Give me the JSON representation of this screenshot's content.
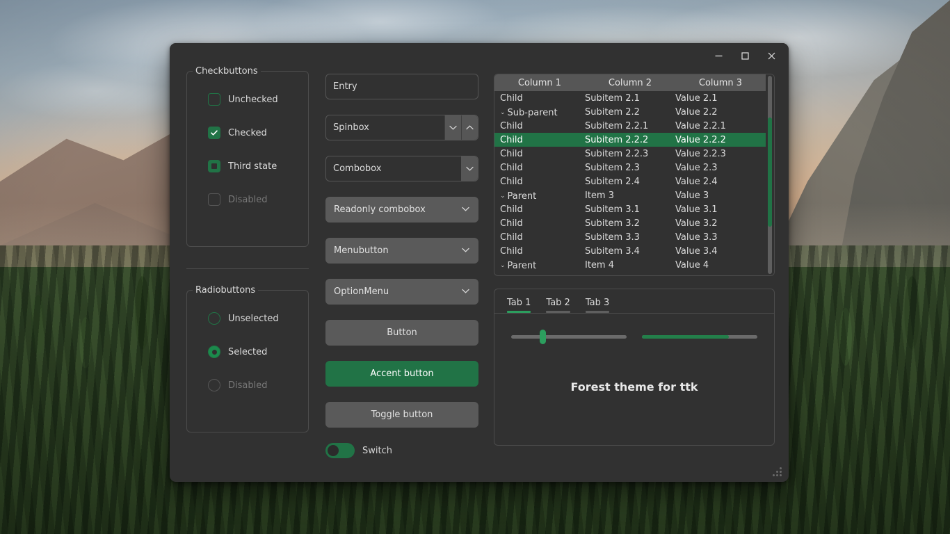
{
  "window": {
    "title": "Forest theme for ttk",
    "controls": {
      "minimize": "minimize-icon",
      "maximize": "maximize-icon",
      "close": "close-icon"
    }
  },
  "checkbuttons": {
    "title": "Checkbuttons",
    "items": [
      {
        "label": "Unchecked",
        "state": "unchecked"
      },
      {
        "label": "Checked",
        "state": "checked"
      },
      {
        "label": "Third state",
        "state": "third"
      },
      {
        "label": "Disabled",
        "state": "disabled"
      }
    ]
  },
  "radiobuttons": {
    "title": "Radiobuttons",
    "items": [
      {
        "label": "Unselected",
        "state": "unselected"
      },
      {
        "label": "Selected",
        "state": "selected"
      },
      {
        "label": "Disabled",
        "state": "disabled"
      }
    ]
  },
  "widgets": {
    "entry": {
      "value": "Entry",
      "placeholder": "Entry"
    },
    "spinbox": {
      "value": "Spinbox",
      "down_icon": "chevron-down-icon",
      "up_icon": "chevron-up-icon"
    },
    "combobox": {
      "value": "Combobox",
      "icon": "chevron-down-icon"
    },
    "readonly_combobox": {
      "value": "Readonly combobox",
      "icon": "chevron-down-icon"
    },
    "menubutton": {
      "value": "Menubutton",
      "icon": "chevron-down-icon"
    },
    "optionmenu": {
      "value": "OptionMenu",
      "icon": "chevron-down-icon"
    },
    "button": {
      "label": "Button"
    },
    "accent_button": {
      "label": "Accent button"
    },
    "toggle_button": {
      "label": "Toggle button"
    },
    "switch": {
      "label": "Switch",
      "state": "on"
    }
  },
  "treeview": {
    "columns": [
      "Column 1",
      "Column 2",
      "Column 3"
    ],
    "rows": [
      {
        "c1": "Child",
        "c2": "Subitem 2.1",
        "c3": "Value 2.1",
        "indent": 1,
        "expander": "",
        "selected": false
      },
      {
        "c1": "Sub-parent",
        "c2": "Subitem 2.2",
        "c3": "Value 2.2",
        "indent": 1,
        "expander": "⌄",
        "selected": false
      },
      {
        "c1": "Child",
        "c2": "Subitem 2.2.1",
        "c3": "Value 2.2.1",
        "indent": 2,
        "expander": "",
        "selected": false
      },
      {
        "c1": "Child",
        "c2": "Subitem 2.2.2",
        "c3": "Value 2.2.2",
        "indent": 2,
        "expander": "",
        "selected": true
      },
      {
        "c1": "Child",
        "c2": "Subitem 2.2.3",
        "c3": "Value 2.2.3",
        "indent": 2,
        "expander": "",
        "selected": false
      },
      {
        "c1": "Child",
        "c2": "Subitem 2.3",
        "c3": "Value 2.3",
        "indent": 1,
        "expander": "",
        "selected": false
      },
      {
        "c1": "Child",
        "c2": "Subitem 2.4",
        "c3": "Value 2.4",
        "indent": 1,
        "expander": "",
        "selected": false
      },
      {
        "c1": "Parent",
        "c2": "Item 3",
        "c3": "Value 3",
        "indent": 0,
        "expander": "⌄",
        "selected": false
      },
      {
        "c1": "Child",
        "c2": "Subitem 3.1",
        "c3": "Value 3.1",
        "indent": 1,
        "expander": "",
        "selected": false
      },
      {
        "c1": "Child",
        "c2": "Subitem 3.2",
        "c3": "Value 3.2",
        "indent": 1,
        "expander": "",
        "selected": false
      },
      {
        "c1": "Child",
        "c2": "Subitem 3.3",
        "c3": "Value 3.3",
        "indent": 1,
        "expander": "",
        "selected": false
      },
      {
        "c1": "Child",
        "c2": "Subitem 3.4",
        "c3": "Value 3.4",
        "indent": 1,
        "expander": "",
        "selected": false
      },
      {
        "c1": "Parent",
        "c2": "Item 4",
        "c3": "Value 4",
        "indent": 0,
        "expander": "⌄",
        "selected": false
      }
    ],
    "scrollbar": {
      "thumb_top_pct": 21,
      "thumb_height_pct": 55
    }
  },
  "notebook": {
    "tabs": [
      {
        "label": "Tab 1",
        "active": true
      },
      {
        "label": "Tab 2",
        "active": false
      },
      {
        "label": "Tab 3",
        "active": false
      }
    ],
    "scale": {
      "value_pct": 27
    },
    "progress": {
      "value_pct": 75
    },
    "heading": "Forest theme for ttk"
  },
  "colors": {
    "accent": "#217346",
    "accent_light": "#2c9e5e",
    "window_bg": "#313131",
    "widget_bg": "#565656",
    "border": "#4c4c4c",
    "text": "#dcdcdc",
    "text_disabled": "#787878"
  }
}
